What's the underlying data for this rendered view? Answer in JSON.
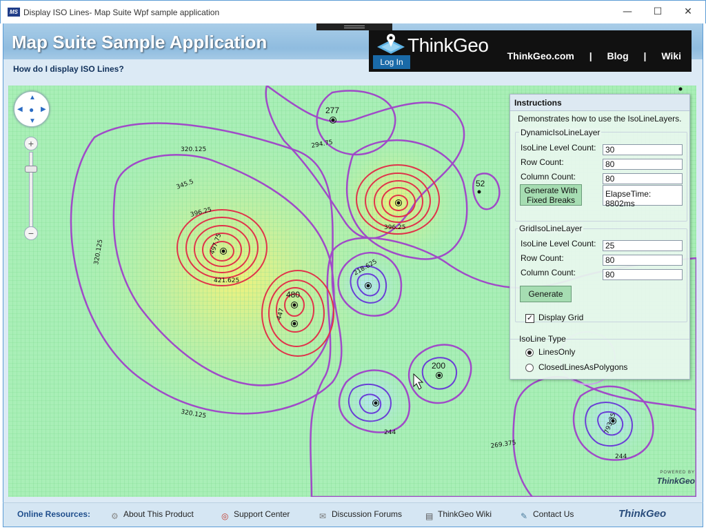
{
  "window": {
    "app_icon": "MS",
    "title": "Display ISO Lines- Map Suite Wpf sample application",
    "minimize": "—",
    "maximize": "☐",
    "close": "✕"
  },
  "header": {
    "title": "Map Suite Sample Application",
    "subtitle": "How do I display ISO Lines?",
    "brand": "ThinkGeo",
    "login": "Log In",
    "links": [
      "ThinkGeo.com",
      "|",
      "Blog",
      "|",
      "Wiki"
    ]
  },
  "map": {
    "points": [
      {
        "label": "277"
      },
      {
        "label": "480"
      },
      {
        "label": "200"
      },
      {
        "label": "52"
      }
    ],
    "contours": [
      "320.125",
      "345.5",
      "396.25",
      "421.625",
      "294.75",
      "269.375",
      "244",
      "218.625",
      "497.75",
      "793.25",
      "447",
      "396.25"
    ],
    "powered_by": "POWERED BY",
    "powered_brand": "ThinkGeo"
  },
  "panel": {
    "title": "Instructions",
    "description": "Demonstrates how to use the IsoLineLayers.",
    "dynamic": {
      "legend": "DynamicIsoLineLayer",
      "level_label": "IsoLine Level Count:",
      "level_value": "30",
      "row_label": "Row Count:",
      "row_value": "80",
      "col_label": "Column Count:",
      "col_value": "80",
      "button": "Generate With Fixed Breaks",
      "elapse": "ElapseTime: 8802ms"
    },
    "grid": {
      "legend": "GridIsoLineLayer",
      "level_label": "IsoLine Level Count:",
      "level_value": "25",
      "row_label": "Row Count:",
      "row_value": "80",
      "col_label": "Column Count:",
      "col_value": "80",
      "button": "Generate"
    },
    "display_grid": "Display Grid",
    "iso_type": {
      "label": "IsoLine Type",
      "opt1": "LinesOnly",
      "opt2": "ClosedLinesAsPolygons"
    }
  },
  "footer": {
    "heading": "Online Resources:",
    "items": [
      "About This Product",
      "Support Center",
      "Discussion Forums",
      "ThinkGeo Wiki",
      "Contact Us"
    ],
    "logo": "ThinkGeo"
  }
}
